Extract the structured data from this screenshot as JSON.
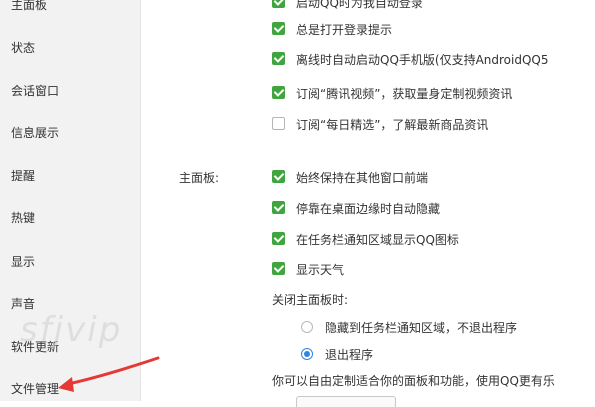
{
  "sidebar": {
    "items": [
      {
        "label": "主面板"
      },
      {
        "label": "状态"
      },
      {
        "label": "会话窗口"
      },
      {
        "label": "信息展示"
      },
      {
        "label": "提醒"
      },
      {
        "label": "热键"
      },
      {
        "label": "显示"
      },
      {
        "label": "声音"
      },
      {
        "label": "软件更新"
      },
      {
        "label": "文件管理"
      }
    ]
  },
  "login_options": [
    {
      "label": "启动QQ时为我自动登录",
      "checked": true
    },
    {
      "label": "总是打开登录提示",
      "checked": true
    },
    {
      "label": "离线时自动启动QQ手机版(仅支持AndroidQQ5",
      "checked": true
    },
    {
      "label": "订阅“腾讯视频”，获取量身定制视频资讯",
      "checked": true
    },
    {
      "label": "订阅“每日精选”，了解最新商品资讯",
      "checked": false
    }
  ],
  "main_panel": {
    "section_label": "主面板:",
    "options": [
      {
        "label": "始终保持在其他窗口前端",
        "checked": true
      },
      {
        "label": "停靠在桌面边缘时自动隐藏",
        "checked": true
      },
      {
        "label": "在任务栏通知区域显示QQ图标",
        "checked": true
      },
      {
        "label": "显示天气",
        "checked": true
      }
    ],
    "close_label": "关闭主面板时:",
    "close_options": [
      {
        "label": "隐藏到任务栏通知区域，不退出程序",
        "selected": false
      },
      {
        "label": "退出程序",
        "selected": true
      }
    ],
    "footer_text": "你可以自由定制适合你的面板和功能，使用QQ更有乐"
  },
  "watermark": "sfjvip",
  "colors": {
    "checkbox_on": "#3fa63f",
    "radio_on": "#2f85e0",
    "arrow": "#e53935",
    "sidebar_bg": "#f2f2f2"
  }
}
